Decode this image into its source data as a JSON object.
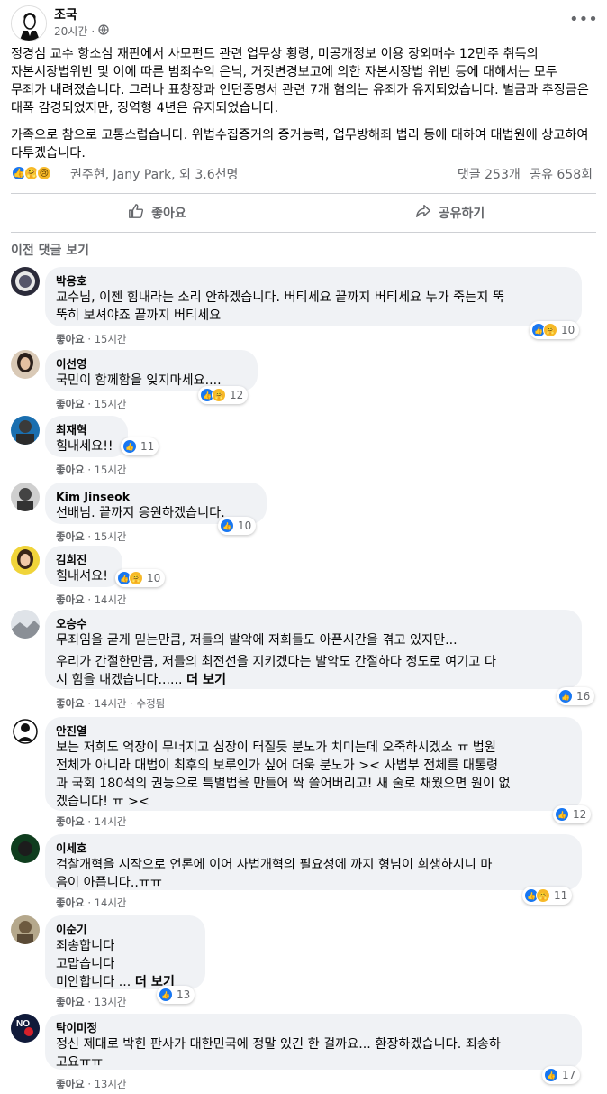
{
  "post": {
    "author": "조국",
    "time": "20시간",
    "privacy_icon": "globe-icon",
    "more_icon": "more-horizontal-icon",
    "paragraphs": [
      "정경심 교수 항소심 재판에서 사모펀드 관련 업무상 횡령, 미공개정보 이용 장외매수 12만주 취득의 자본시장법위반 및 이에 따른 범죄수익 은닉, 거짓변경보고에 의한 자본시장법 위반 등에 대해서는 모두 무죄가 내려졌습니다. 그러나 표창장과 인턴증명서 관련 7개 혐의는 유죄가 유지되었습니다. 벌금과 추징금은 대폭 감경되었지만, 징역형 4년은 유지되었습니다.",
      "가족으로 참으로 고통스럽습니다. 위법수집증거의 증거능력, 업무방해죄 법리 등에 대하여 대법원에 상고하여 다투겠습니다."
    ],
    "reaction_names": "권주현, Jany Park, 외 3.6천명",
    "comment_count": "댓글 253개",
    "share_count": "공유 658회"
  },
  "actions": {
    "like_label": "좋아요",
    "share_label": "공유하기"
  },
  "comments_header": "이전 댓글 보기",
  "comments": [
    {
      "name": "박용호",
      "lines": [
        "교수님, 이젠 힘내라는 소리 안하겠습니다. 버티세요 끝까지 버티세요 누가 죽는지 뚝",
        "뚝히 보셔야죠 끝까지 버티세요"
      ],
      "like": "좋아요",
      "time": "15시간",
      "count": "10"
    },
    {
      "name": "이선영",
      "lines": [
        "국민이 함께함을 잊지마세요...."
      ],
      "like": "좋아요",
      "time": "15시간",
      "count": "12"
    },
    {
      "name": "최재혁",
      "lines": [
        "힘내세요!!"
      ],
      "like": "좋아요",
      "time": "15시간",
      "count": "11"
    },
    {
      "name": "Kim Jinseok",
      "lines": [
        "선배님. 끝까지 응원하겠습니다."
      ],
      "like": "좋아요",
      "time": "15시간",
      "count": "10"
    },
    {
      "name": "김희진",
      "lines": [
        "힘내셔요!"
      ],
      "like": "좋아요",
      "time": "14시간",
      "count": "10"
    },
    {
      "name": "오승수",
      "lines": [
        "무죄임을 굳게 믿는만큼, 저들의 발악에 저희들도 아픈시간을 겪고 있지만...",
        "",
        "우리가 간절한만큼, 저들의 최전선을 지키겠다는 발악도 간절하다 정도로 여기고 다",
        "시 힘을 내겠습니다......"
      ],
      "see_more": "더 보기",
      "like": "좋아요",
      "time": "14시간",
      "edited": "수정됨",
      "count": "16"
    },
    {
      "name": "안진열",
      "lines": [
        "보는 저희도 억장이 무너지고 심장이 터질듯 분노가 치미는데 오죽하시겠소 ㅠ 법원",
        "전체가 아니라 대법이 최후의 보루인가 싶어 더욱 분노가 >< 사법부 전체를 대통령",
        "과 국회 180석의 권능으로 특별법을 만들어 싹 쓸어버리고! 새 술로 채웠으면 원이 없",
        "겠습니다! ㅠ ><"
      ],
      "like": "좋아요",
      "time": "14시간",
      "count": "12"
    },
    {
      "name": "이세호",
      "lines": [
        "검찰개혁을 시작으로 언론에 이어 사법개혁의 필요성에 까지 형님이 희생하시니 마",
        "음이 아픕니다..ㅠㅠ"
      ],
      "like": "좋아요",
      "time": "14시간",
      "count": "11"
    },
    {
      "name": "이순기",
      "lines": [
        "죄송합니다",
        "고맙습니다",
        "미안합니다 ..."
      ],
      "see_more": "더 보기",
      "like": "좋아요",
      "time": "13시간",
      "count": "13"
    },
    {
      "name": "탁이미정",
      "lines": [
        "정신 제대로 박힌 판사가 대한민국에 정말 있긴 한 걸까요... 환장하겠습니다. 죄송하",
        "고요ㅠㅠ"
      ],
      "like": "좋아요",
      "time": "13시간",
      "count": "17"
    }
  ],
  "colors": {
    "accent": "#1877f2",
    "muted": "#65676b",
    "bubble": "#f0f2f5"
  }
}
